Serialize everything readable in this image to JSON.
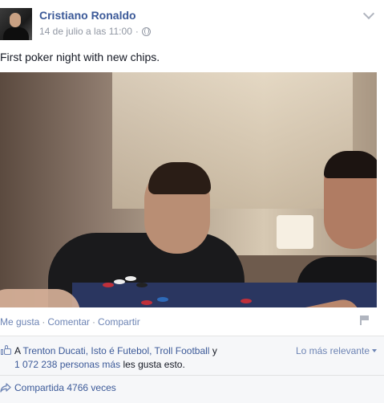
{
  "post": {
    "author": "Cristiano Ronaldo",
    "timestamp": "14 de julio a las 11:00",
    "meta_separator": "·",
    "privacy_icon": "globe-icon",
    "menu_icon": "chevron-down-icon",
    "text": "First poker night with new chips."
  },
  "actions": {
    "like": "Me gusta",
    "comment": "Comentar",
    "share": "Compartir",
    "separator": "·",
    "flag_icon": "flag-icon"
  },
  "feedback": {
    "like_icon": "thumbs-up-icon",
    "prefix": "A",
    "names": "Trenton Ducati, Isto é Futebol, Troll Football",
    "connector": "y",
    "others": "1 072 238 personas más",
    "suffix": "les gusta esto.",
    "sort_label": "Lo más relevante",
    "share_icon": "share-arrow-icon",
    "shares": "Compartida 4766 veces"
  },
  "colors": {
    "link": "#3b5998",
    "muted": "#9197a3",
    "action_link": "#6d84b4",
    "feedback_bg": "#f6f7f9"
  }
}
